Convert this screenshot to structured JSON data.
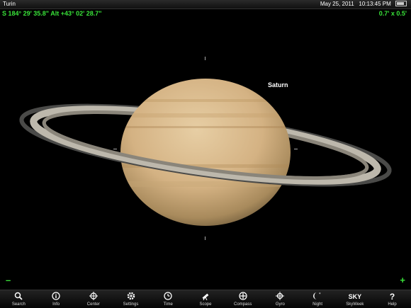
{
  "status_bar": {
    "location": "Turin",
    "date": "May 25, 2011",
    "time": "10:13:45 PM"
  },
  "coordinates": "S 184° 29' 35.8\" Alt +43° 02' 28.7\"",
  "field_of_view": "0.7' x 0.5'",
  "object_label": "Saturn",
  "zoom": {
    "minus": "–",
    "plus": "+"
  },
  "colors": {
    "accent": "#39e339",
    "background": "#000000"
  },
  "toolbar": [
    {
      "label": "Search",
      "icon": "search-icon"
    },
    {
      "label": "Info",
      "icon": "info-icon"
    },
    {
      "label": "Center",
      "icon": "crosshair-icon"
    },
    {
      "label": "Settings",
      "icon": "gear-icon"
    },
    {
      "label": "Time",
      "icon": "clock-icon"
    },
    {
      "label": "Scope",
      "icon": "telescope-icon"
    },
    {
      "label": "Compass",
      "icon": "compass-icon"
    },
    {
      "label": "Gyro",
      "icon": "gyro-icon"
    },
    {
      "label": "Night",
      "icon": "moon-star-icon"
    },
    {
      "label": "SkyWeek",
      "icon": "skyweek-icon",
      "icon_text": "SKY"
    },
    {
      "label": "Help",
      "icon": "help-icon",
      "icon_text": "?"
    }
  ]
}
